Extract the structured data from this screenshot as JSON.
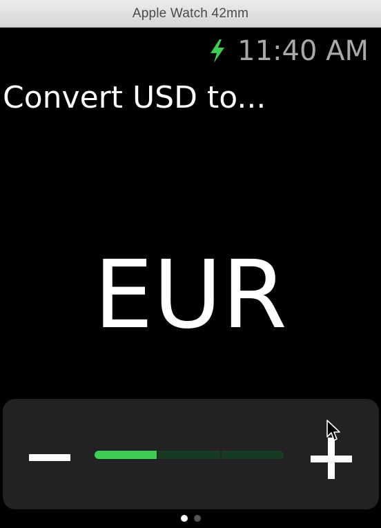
{
  "window": {
    "title": "Apple Watch 42mm"
  },
  "status_bar": {
    "charging_icon": "lightning-bolt-icon",
    "charging_color": "#3ecc55",
    "time": "11:40 AM"
  },
  "interface": {
    "heading": "Convert USD to...",
    "selected_currency": "EUR"
  },
  "slider": {
    "decrement_icon": "minus-icon",
    "increment_icon": "plus-icon",
    "steps": 3,
    "value": 1,
    "accent_color": "#3ecc55",
    "track_color": "#173a21"
  },
  "pagination": {
    "pages": 2,
    "current_page": 1
  }
}
